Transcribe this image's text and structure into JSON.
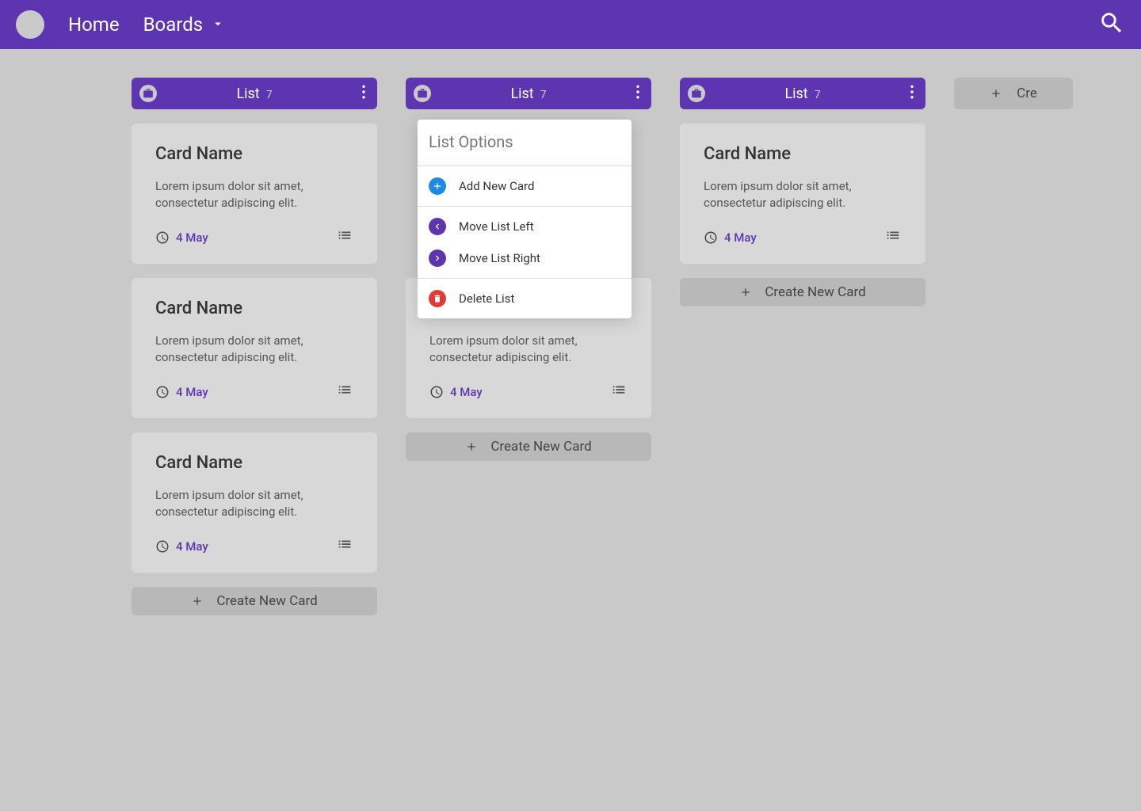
{
  "nav": {
    "home": "Home",
    "boards": "Boards"
  },
  "lists": [
    {
      "title": "List",
      "count": "7"
    },
    {
      "title": "List",
      "count": "7"
    },
    {
      "title": "List",
      "count": "7"
    }
  ],
  "card": {
    "title": "Card Name",
    "desc": "Lorem ipsum dolor sit amet, consectetur adipiscing elit.",
    "date": "4 May"
  },
  "createCard": "Create New Card",
  "createList": "Cre",
  "popover": {
    "title": "List Options",
    "addCard": "Add New Card",
    "moveLeft": "Move List Left",
    "moveRight": "Move List Right",
    "delete": "Delete List"
  }
}
